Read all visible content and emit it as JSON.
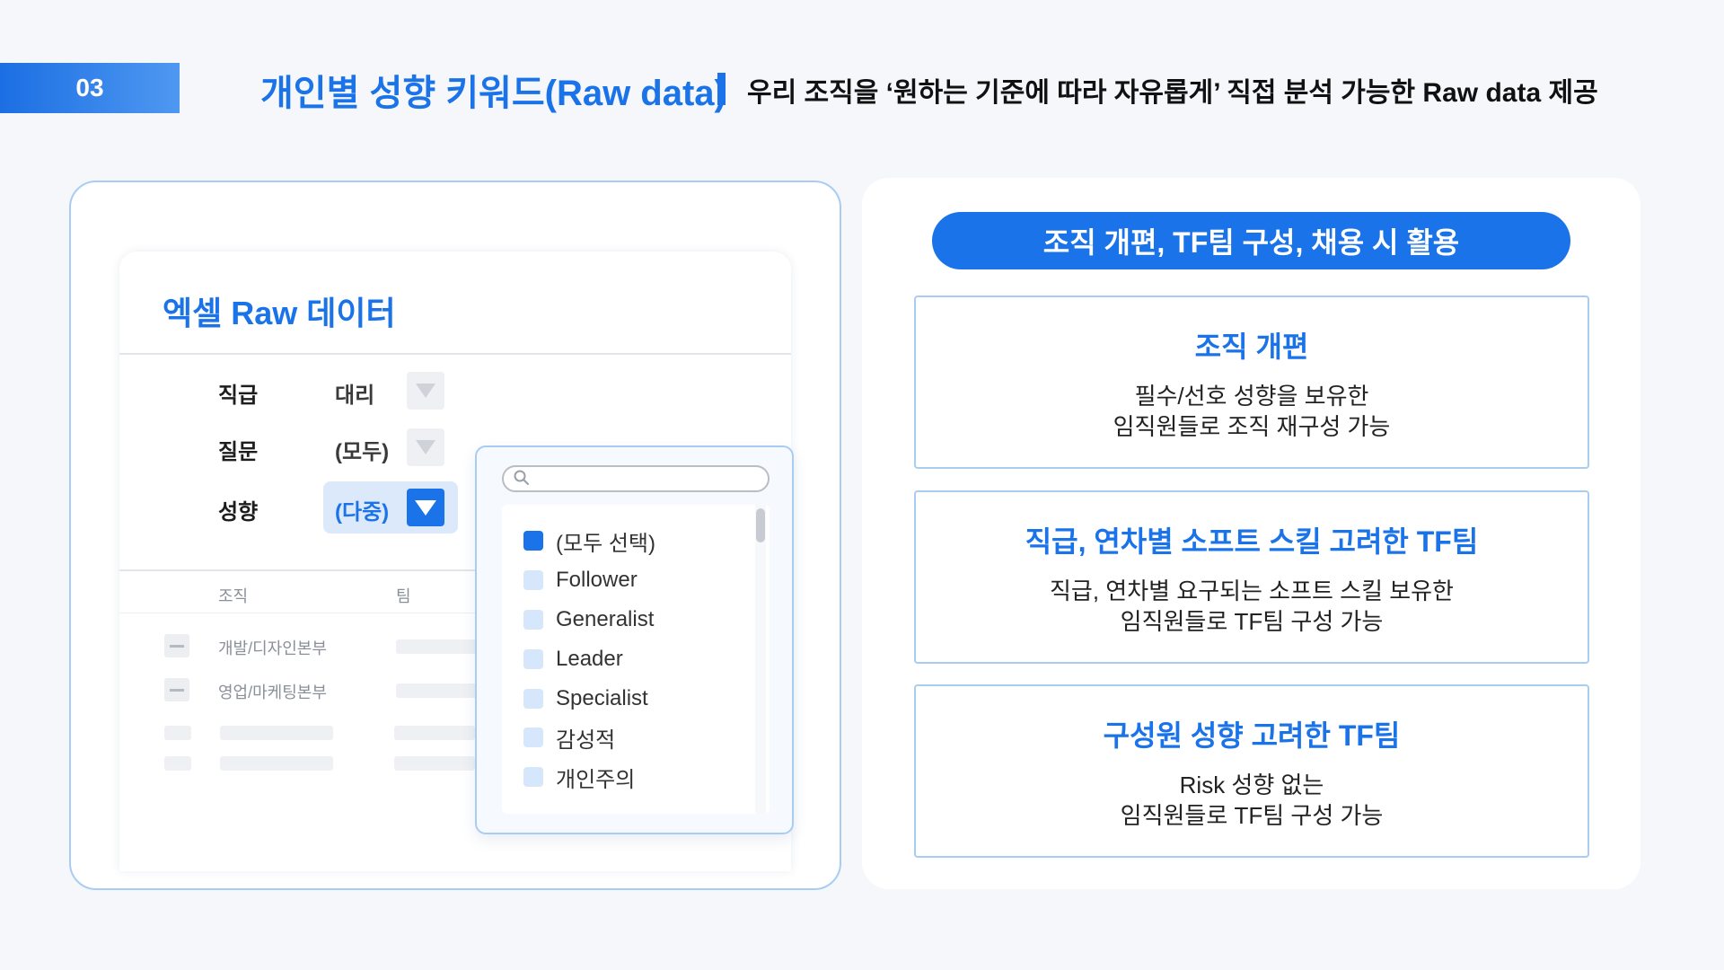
{
  "header": {
    "page_number": "03",
    "title": "개인별 성향 키워드(Raw data)",
    "subtitle": "우리 조직을 ‘원하는 기준에 따라 자유롭게’ 직접 분석 가능한 Raw data 제공"
  },
  "excel": {
    "title": "엑셀 Raw 데이터",
    "filters": [
      {
        "label": "직급",
        "value": "대리"
      },
      {
        "label": "질문",
        "value": "(모두)"
      },
      {
        "label": "성향",
        "value": "(다중)"
      }
    ],
    "columns": [
      "조직",
      "팀"
    ],
    "rows": [
      "개발/디자인본부",
      "영업/마케팅본부"
    ]
  },
  "dropdown": {
    "search_placeholder": "",
    "items": [
      {
        "label": "(모두 선택)",
        "checked": true
      },
      {
        "label": "Follower",
        "checked": false
      },
      {
        "label": "Generalist",
        "checked": false
      },
      {
        "label": "Leader",
        "checked": false
      },
      {
        "label": "Specialist",
        "checked": false
      },
      {
        "label": "감성적",
        "checked": false
      },
      {
        "label": "개인주의",
        "checked": false
      }
    ]
  },
  "usage": {
    "pill": "조직 개편, TF팀 구성, 채용 시 활용",
    "cards": [
      {
        "title": "조직 개편",
        "lines": [
          "필수/선호 성향을 보유한",
          "임직원들로 조직 재구성 가능"
        ]
      },
      {
        "title": "직급, 연차별 소프트 스킬 고려한 TF팀",
        "lines": [
          "직급, 연차별 요구되는 소프트 스킬 보유한",
          "임직원들로 TF팀 구성 가능"
        ]
      },
      {
        "title": "구성원 성향 고려한 TF팀",
        "lines": [
          "Risk 성향 없는",
          "임직원들로 TF팀 구성 가능"
        ]
      }
    ]
  },
  "colors": {
    "accent": "#1a73e8",
    "panel_border": "#a9ccf3",
    "background": "#f5f7fb"
  },
  "icons": [
    "search-icon",
    "chevron-down-icon",
    "checkbox-icon",
    "minus-icon"
  ]
}
